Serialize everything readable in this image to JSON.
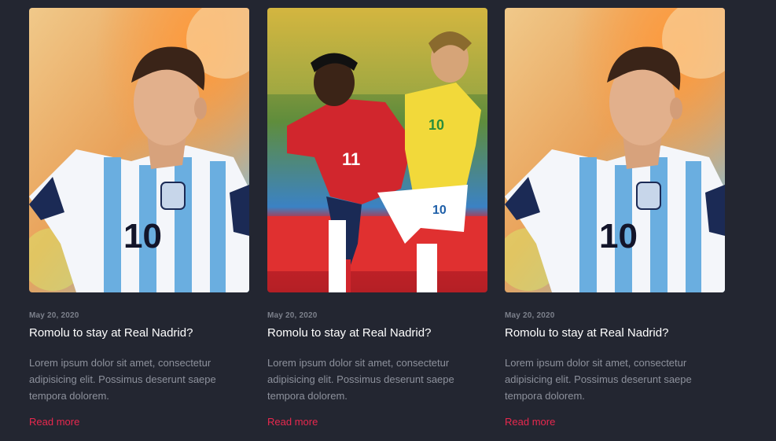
{
  "cards": [
    {
      "image": "messi-argentina-photo",
      "date": "May 20, 2020",
      "title": "Romolu to stay at Real Nadrid?",
      "excerpt": "Lorem ipsum dolor sit amet, consectetur adipisicing elit. Possimus deserunt saepe tempora dolorem.",
      "link": "Read more"
    },
    {
      "image": "colombia-vs-brazil-photo",
      "date": "May 20, 2020",
      "title": "Romolu to stay at Real Nadrid?",
      "excerpt": "Lorem ipsum dolor sit amet, consectetur adipisicing elit. Possimus deserunt saepe tempora dolorem.",
      "link": "Read more"
    },
    {
      "image": "messi-argentina-photo",
      "date": "May 20, 2020",
      "title": "Romolu to stay at Real Nadrid?",
      "excerpt": "Lorem ipsum dolor sit amet, consectetur adipisicing elit. Possimus deserunt saepe tempora dolorem.",
      "link": "Read more"
    }
  ],
  "colors": {
    "background": "#232631",
    "link": "#e8284e",
    "title": "#ffffff",
    "muted": "#8d919c"
  }
}
